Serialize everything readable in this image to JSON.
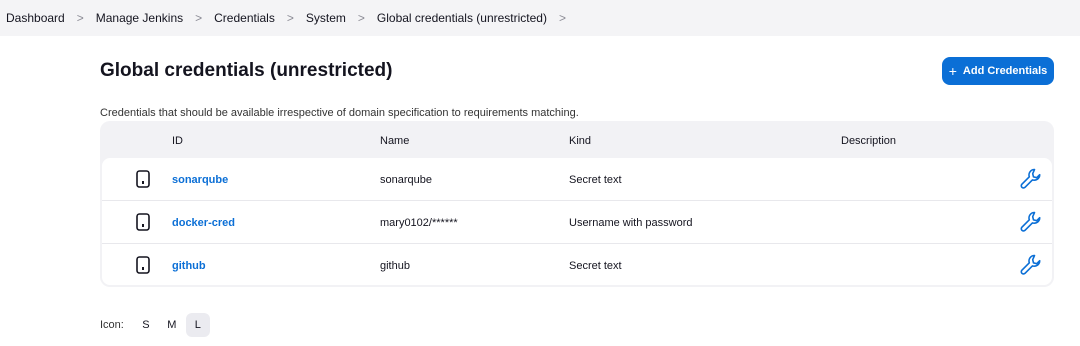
{
  "breadcrumb": [
    "Dashboard",
    "Manage Jenkins",
    "Credentials",
    "System",
    "Global credentials (unrestricted)"
  ],
  "breadcrumb_separator": ">",
  "page": {
    "title": "Global credentials (unrestricted)",
    "description": "Credentials that should be available irrespective of domain specification to requirements matching."
  },
  "actions": {
    "add_plus": "+",
    "add_label": "Add Credentials"
  },
  "table": {
    "headers": {
      "id": "ID",
      "name": "Name",
      "kind": "Kind",
      "description": "Description"
    },
    "rows": [
      {
        "id": "sonarqube",
        "name": "sonarqube",
        "kind": "Secret text",
        "description": "",
        "icon": "credential-token-icon"
      },
      {
        "id": "docker-cred",
        "name": "mary0102/******",
        "kind": "Username with password",
        "description": "",
        "icon": "credential-token-icon"
      },
      {
        "id": "github",
        "name": "github",
        "kind": "Secret text",
        "description": "",
        "icon": "credential-token-icon"
      }
    ]
  },
  "icon_size": {
    "label": "Icon:",
    "options": [
      "S",
      "M",
      "L"
    ],
    "selected": "L"
  },
  "colors": {
    "accent": "#0b6fd6",
    "breadcrumb_bg": "#f4f4f6",
    "table_bg": "#f2f2f5"
  }
}
